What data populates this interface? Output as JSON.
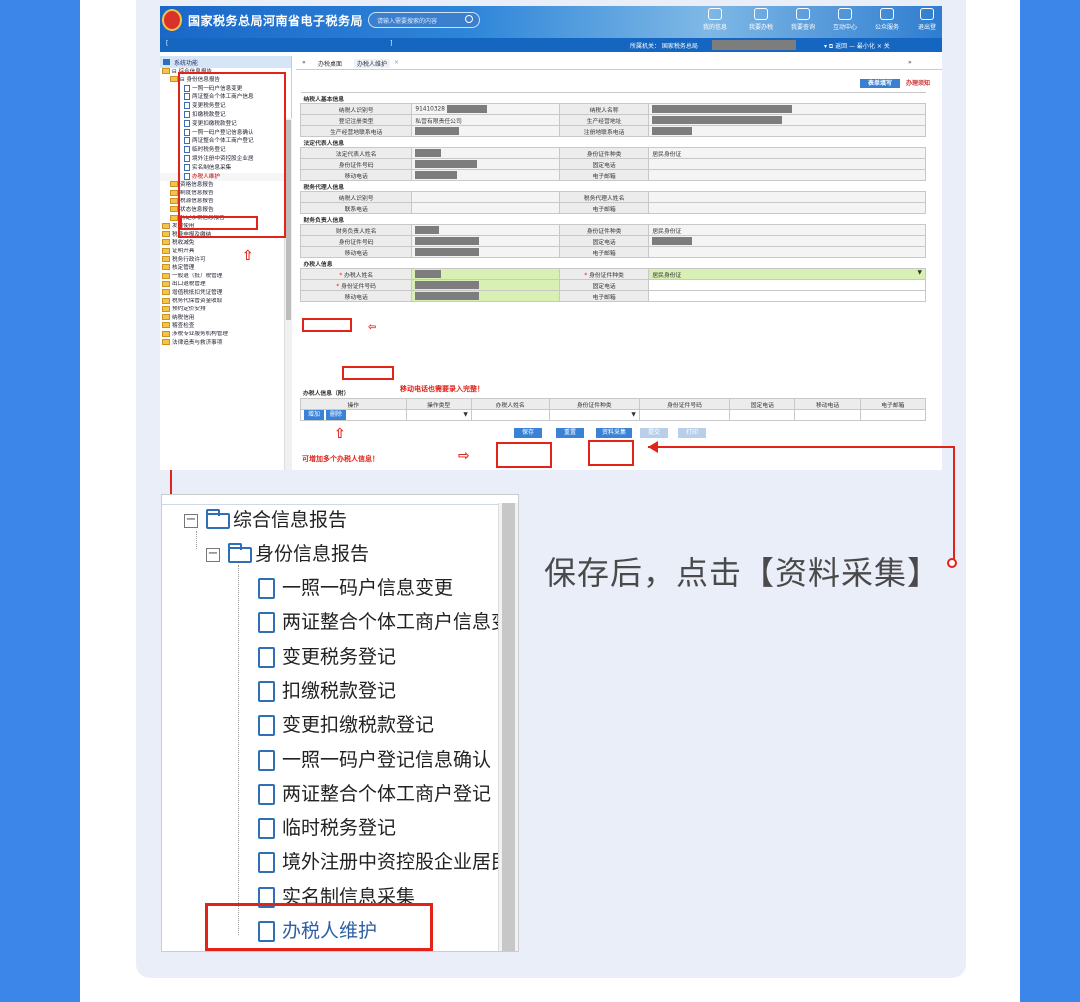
{
  "theme": {
    "accent": "#e2231a",
    "brand": "#1566c0",
    "bg": "#3b86e8"
  },
  "site": {
    "title": "国家税务总局河南省电子税务局",
    "search_placeholder": "请输入需要搜索的内容",
    "nav": [
      "我的信息",
      "我要办税",
      "我要查询",
      "互动中心",
      "公众服务",
      "退出登"
    ],
    "info_left": "[",
    "info_left_end": "]",
    "info_mid": "所属机关：  国家税务总局",
    "info_right": "▾  ⧉ 返回  — 最小化  × 关"
  },
  "sidebar": {
    "header": "系统功能",
    "items": [
      "⊟ 综合信息报告",
      "⊟ 身份信息报告",
      "一照一码户信息变更",
      "两证整合个体工商户信息",
      "变更税务登记",
      "扣缴税款登记",
      "变更扣缴税款登记",
      "一照一码户登记信息确认",
      "两证整合个体工商户登记",
      "临时税务登记",
      "境外注册中资控股企业居",
      "实名制信息采集",
      "办税人维护",
      "资格信息报告",
      "制度信息报告",
      "税源信息报告",
      "状态信息报告",
      "特定涉税信息报告",
      "发票使用",
      "税费申报及缴纳",
      "税收减免",
      "证明开具",
      "税务行政许可",
      "核定管理",
      "一般退（抵）税管理",
      "出口退税管理",
      "增值税抵扣凭证管理",
      "税务代保管资金收取",
      "预约定价安排",
      "纳税信用",
      "稽查检查",
      "涉税专业服务机构管理",
      "法律追责与救济事项"
    ]
  },
  "tabs": {
    "home": "办税桌面",
    "current": "办税人维护",
    "close": "×",
    "prev": "«",
    "next": "»"
  },
  "mode_tabs": {
    "fill": "表单填写",
    "guide": "办理须知"
  },
  "form": {
    "sec_top": "纳税人基本信息",
    "taxpayer_id_label": "纳税人识别号",
    "taxpayer_id_value": "91410328",
    "taxpayer_name_label": "纳税人名称",
    "reg_type_label": "登记注册类型",
    "reg_type_value": "私营有限责任公司",
    "biz_addr_label": "生产经营地址",
    "biz_phone_label": "生产经营地联系电话",
    "reg_phone_label": "注册地联系电话",
    "sec_legal": "法定代表人信息",
    "legal_name_label": "法定代表人姓名",
    "id_type_label": "身份证件种类",
    "id_type_value": "居民身份证",
    "id_no_label": "身份证件号码",
    "fixed_phone_label": "固定电话",
    "mobile_label": "移动电话",
    "email_label": "电子邮箱",
    "sec_agent": "税务代理人信息",
    "agent_id_label": "纳税人识别号",
    "agent_name_label": "税务代理人姓名",
    "contact_phone_label": "联系电话",
    "sec_finance": "财务负责人信息",
    "finance_name_label": "财务负责人姓名",
    "sec_handler": "办税人信息",
    "handler_name_label": "办税人姓名",
    "sec_handler_extra": "办税人信息（附）",
    "grid_headers": [
      "操作",
      "操作类型",
      "办税人姓名",
      "身份证件种类",
      "身份证件号码",
      "固定电话",
      "移动电话",
      "电子邮箱"
    ],
    "add_label": "增加",
    "delete_label": "删除"
  },
  "buttons": {
    "save": "保存",
    "reset": "重置",
    "collect": "资料采集",
    "submit": "提交",
    "print": "打印"
  },
  "annotations": {
    "mobile_note": "移动电话也需要录入完整！",
    "multi_note": "可增加多个办税人信息！"
  },
  "zoom": {
    "items": [
      "综合信息报告",
      "身份信息报告",
      "一照一码户信息变更",
      "两证整合个体工商户信息变",
      "变更税务登记",
      "扣缴税款登记",
      "变更扣缴税款登记",
      "一照一码户登记信息确认",
      "两证整合个体工商户登记",
      "临时税务登记",
      "境外注册中资控股企业居民",
      "实名制信息采集",
      "办税人维护"
    ]
  },
  "caption": "保存后，点击【资料采集】"
}
